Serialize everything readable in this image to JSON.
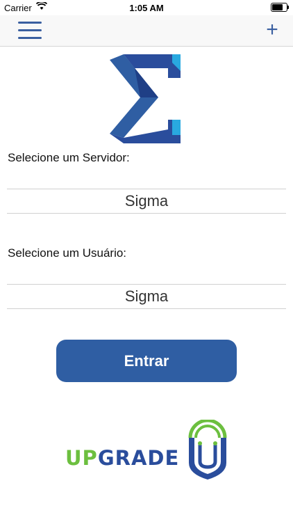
{
  "status_bar": {
    "carrier": "Carrier",
    "time": "1:05 AM"
  },
  "nav": {
    "add_label": "+"
  },
  "server": {
    "label": "Selecione um Servidor:",
    "value": "Sigma"
  },
  "user": {
    "label": "Selecione um Usuário:",
    "value": "Sigma"
  },
  "login": {
    "label": "Entrar"
  },
  "brand": {
    "up": "UP",
    "grade": "GRADE",
    "shield_letter": "U"
  },
  "colors": {
    "primary": "#2f5ea3",
    "green": "#6cbf3f",
    "logo_dark": "#2a4d9c",
    "logo_light": "#29a9e0"
  }
}
